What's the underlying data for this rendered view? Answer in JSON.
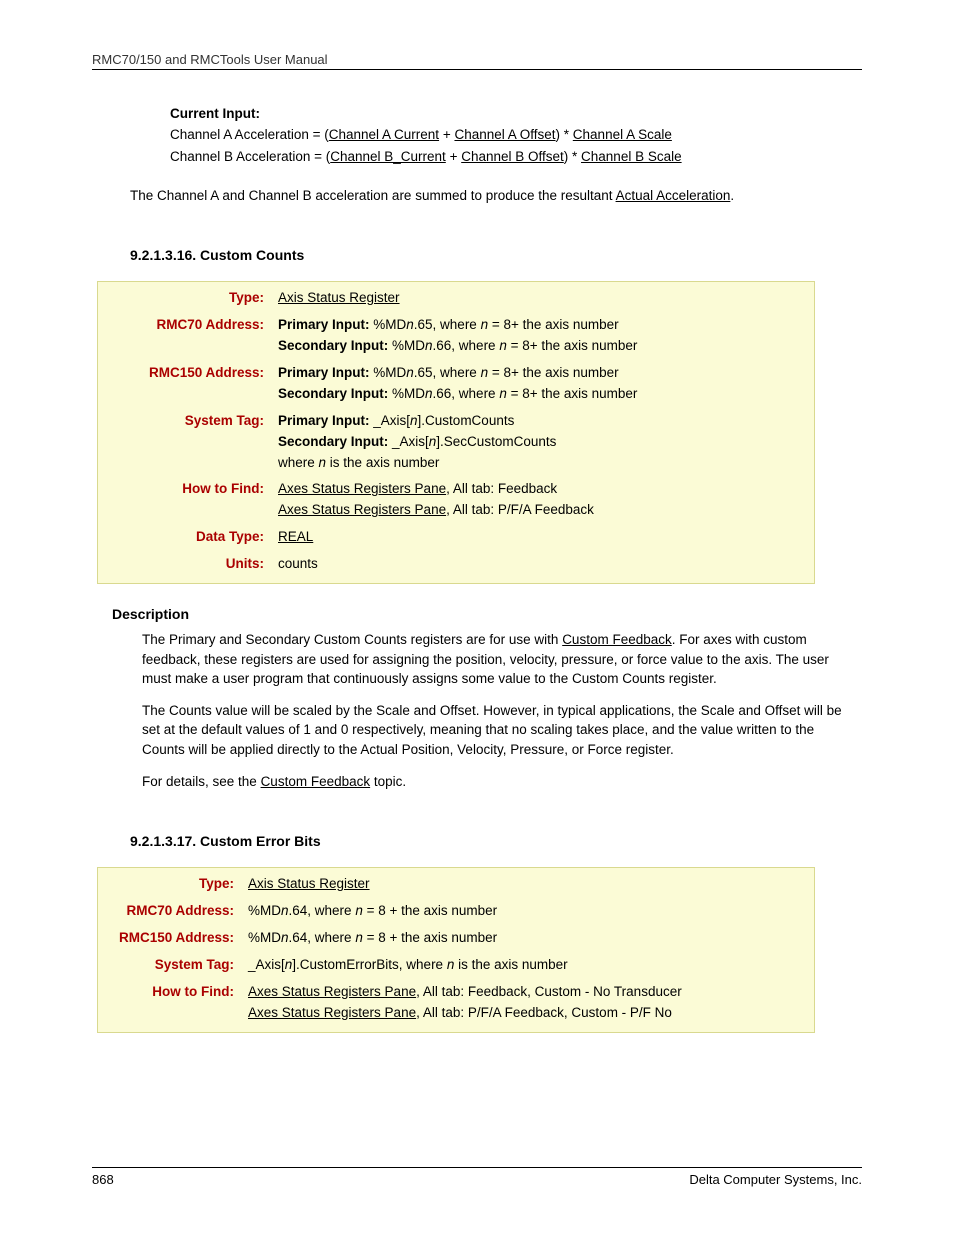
{
  "header": "RMC70/150 and RMCTools User Manual",
  "current_input": {
    "title": "Current Input:",
    "chA_prefix": "Channel A Acceleration =  (",
    "chA_l1": "Channel A  Current",
    "chA_mid1": " + ",
    "chA_l2": "Channel A Offset",
    "chA_mid2": ") * ",
    "chA_l3": "Channel A Scale",
    "chB_prefix": "Channel B Acceleration =  (",
    "chB_l1": "Channel B_Current",
    "chB_mid1": " + ",
    "chB_l2": "Channel B Offset",
    "chB_mid2": ") * ",
    "chB_l3": "Channel B Scale"
  },
  "sum_para": {
    "p1": "The Channel A and Channel B acceleration are summed to produce the resultant ",
    "link": "Actual Acceleration",
    "p2": "."
  },
  "sec16": {
    "num": "9.2.1.3.16. Custom Counts",
    "rows": {
      "type_label": "Type:",
      "type_link": "Axis Status Register",
      "rmc70_label": "RMC70 Address:",
      "rmc70_p1b": "Primary Input: ",
      "rmc70_p1t1": "%MD",
      "rmc70_p1i": "n",
      "rmc70_p1t2": ".65, where ",
      "rmc70_p1i2": "n",
      "rmc70_p1t3": " = 8+ the axis number",
      "rmc70_s1b": "Secondary Input: ",
      "rmc70_s1t1": "%MD",
      "rmc70_s1i": "n",
      "rmc70_s1t2": ".66, where ",
      "rmc70_s1i2": "n",
      "rmc70_s1t3": " = 8+ the axis number",
      "rmc150_label": "RMC150 Address:",
      "systag_label": "System Tag:",
      "systag_p1b": "Primary Input: ",
      "systag_p1t1": "_Axis[",
      "systag_p1i": "n",
      "systag_p1t2": "].CustomCounts",
      "systag_s1b": "Secondary Input: ",
      "systag_s1t1": "_Axis[",
      "systag_s1i": "n",
      "systag_s1t2": "].SecCustomCounts",
      "systag_w1": "where ",
      "systag_wi": "n",
      "systag_w2": " is the axis number",
      "howto_label": "How to Find:",
      "howto_l1": "Axes Status Registers Pane",
      "howto_t1": ", All tab: Feedback",
      "howto_l2": "Axes Status Registers Pane",
      "howto_t2": ", All tab: P/F/A Feedback",
      "dtype_label": "Data Type:",
      "dtype_link": "REAL",
      "units_label": "Units:",
      "units_val": "counts"
    },
    "desc_heading": "Description",
    "desc_p1a": "The Primary and Secondary Custom Counts registers are for use with ",
    "desc_p1link": "Custom Feedback",
    "desc_p1b": ". For axes with custom feedback, these registers are used for assigning the position, velocity, pressure, or force value to the axis. The user must make a user program that continuously assigns some value to the Custom Counts register.",
    "desc_p2": "The Counts value will be scaled by the Scale and Offset. However, in typical applications, the Scale and Offset will be set at the default values of 1 and 0 respectively, meaning that no scaling takes place, and the value written to the Counts will be applied directly to the Actual Position, Velocity, Pressure, or Force register.",
    "desc_p3a": "For details, see the ",
    "desc_p3link": "Custom Feedback",
    "desc_p3b": " topic."
  },
  "sec17": {
    "num": "9.2.1.3.17. Custom Error Bits",
    "rows": {
      "type_label": "Type:",
      "type_link": "Axis Status Register",
      "rmc70_label": "RMC70 Address:",
      "addr_t1": "%MD",
      "addr_i": "n",
      "addr_t2": ".64, where ",
      "addr_i2": "n",
      "addr_t3": " = 8 + the axis number",
      "rmc150_label": "RMC150 Address:",
      "systag_label": "System Tag:",
      "systag_t1": "_Axis[",
      "systag_i": "n",
      "systag_t2": "].CustomErrorBits, where ",
      "systag_i2": "n",
      "systag_t3": " is the axis number",
      "howto_label": "How to Find:",
      "howto_l1": "Axes Status Registers Pane",
      "howto_t1": ", All tab: Feedback, Custom - No Transducer",
      "howto_l2": "Axes Status Registers Pane",
      "howto_t2": ", All tab: P/F/A Feedback, Custom - P/F No"
    }
  },
  "footer": {
    "page": "868",
    "company": "Delta Computer Systems, Inc."
  }
}
